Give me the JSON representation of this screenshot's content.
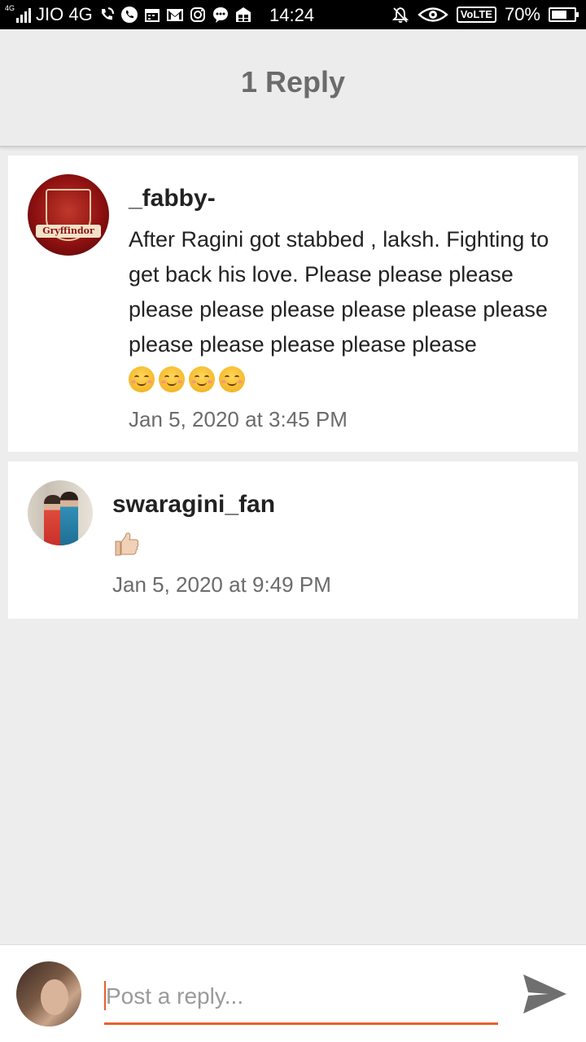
{
  "status_bar": {
    "network_tiny": "4G",
    "carrier": "JIO 4G",
    "time": "14:24",
    "volte": "VoLTE",
    "battery": "70%",
    "battery_level": 0.7,
    "icons": [
      "signal-icon",
      "wifi-call-icon",
      "whatsapp-icon",
      "calendar-icon",
      "gmail-icon",
      "instagram-icon",
      "message-icon",
      "store-icon",
      "mute-icon",
      "eye-icon",
      "battery-icon"
    ]
  },
  "header": {
    "title": "1 Reply"
  },
  "comments": [
    {
      "username": "_fabby-",
      "avatar_text": "Gryffindor",
      "text": "After Ragini got stabbed , laksh. Fighting to get back his love. Please please please please please please please please please please please please please please",
      "emoji": [
        "smiling-face-icon",
        "smiling-face-icon",
        "smiling-face-icon",
        "smiling-face-icon"
      ],
      "timestamp": "Jan 5, 2020 at 3:45 PM"
    },
    {
      "username": "swaragini_fan",
      "emoji": [
        "thumbs-up-icon"
      ],
      "timestamp": "Jan 5, 2020 at 9:49 PM"
    }
  ],
  "reply": {
    "placeholder": "Post a reply...",
    "value": ""
  },
  "colors": {
    "accent": "#e8602c",
    "background": "#ededed",
    "card": "#ffffff",
    "title": "#6b6b6b",
    "send_icon": "#6f6f6f"
  }
}
